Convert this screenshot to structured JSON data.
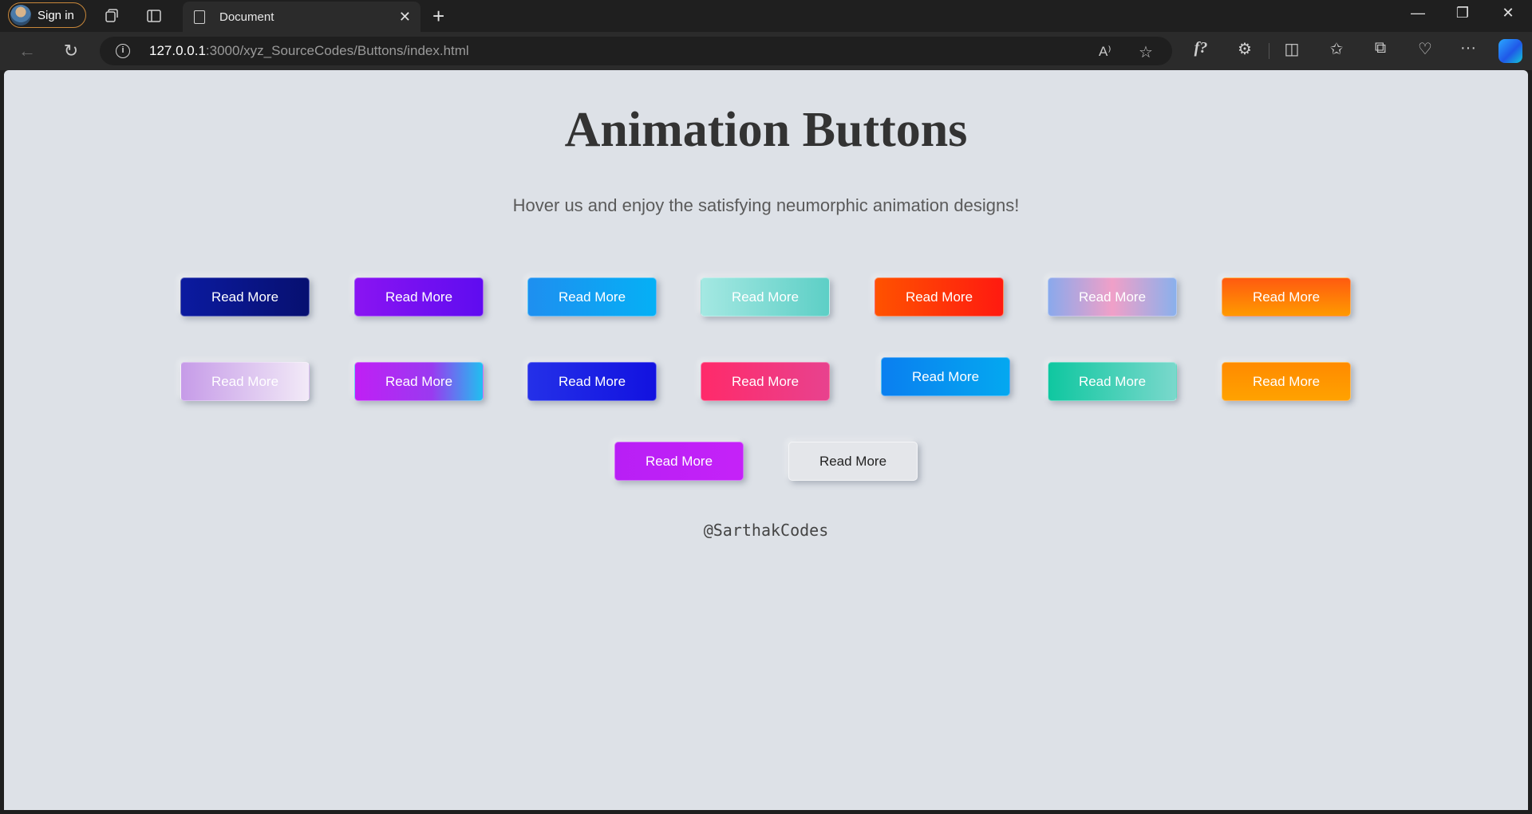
{
  "browser": {
    "profile_label": "Sign in",
    "tab_title": "Document",
    "url_host": "127.0.0.1",
    "url_rest": ":3000/xyz_SourceCodes/Buttons/index.html"
  },
  "page": {
    "title": "Animation Buttons",
    "subtitle": "Hover us and enjoy the satisfying neumorphic animation designs!",
    "footer": "@SarthakCodes",
    "buttons": [
      {
        "label": "Read More",
        "color": "#0a1a8c"
      },
      {
        "label": "Read More",
        "color": "#7a12f0"
      },
      {
        "label": "Read More",
        "color": "#1098f0"
      },
      {
        "label": "Read More",
        "color": "#7fdcd4"
      },
      {
        "label": "Read More",
        "color": "#ff2e0a"
      },
      {
        "label": "Read More",
        "color": "#b0a3e6"
      },
      {
        "label": "Read More",
        "color": "#ff7a00"
      },
      {
        "label": "Read More",
        "color": "#d9b6ef"
      },
      {
        "label": "Read More",
        "color": "#a22cf7"
      },
      {
        "label": "Read More",
        "color": "#1c22e8"
      },
      {
        "label": "Read More",
        "color": "#f0327a"
      },
      {
        "label": "Read More",
        "color": "#0a90ee"
      },
      {
        "label": "Read More",
        "color": "#21c9a4"
      },
      {
        "label": "Read More",
        "color": "#ff9a00"
      },
      {
        "label": "Read More",
        "color": "#b31ff5"
      },
      {
        "label": "Read More",
        "color": "#e6e8ec"
      }
    ]
  }
}
